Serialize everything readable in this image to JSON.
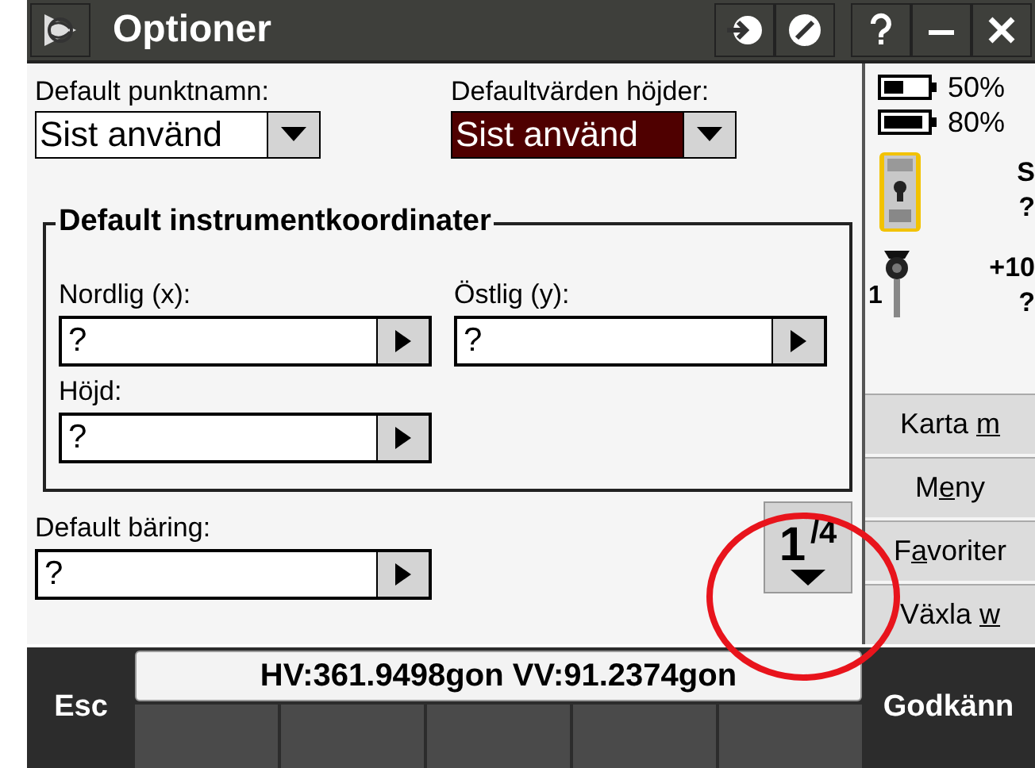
{
  "window": {
    "title": "Optioner"
  },
  "top_fields": [
    {
      "label": "Default punktnamn:",
      "value": "Sist använd",
      "selected": false
    },
    {
      "label": "Defaultvärden höjder:",
      "value": "Sist använd",
      "selected": true
    }
  ],
  "group": {
    "title": "Default instrumentkoordinater",
    "fields": [
      {
        "label": "Nordlig (x):",
        "value": "?"
      },
      {
        "label": "Östlig (y):",
        "value": "?"
      },
      {
        "label": "Höjd:",
        "value": "?"
      }
    ]
  },
  "bearing": {
    "label": "Default bäring:",
    "value": "?"
  },
  "page_button": "1$^{/4}$",
  "status": {
    "batteries": [
      "50%",
      "80%"
    ],
    "instrument": [
      "S",
      "?"
    ],
    "target": {
      "number": "1",
      "offset": "+10",
      "value": "?"
    }
  },
  "softkeys": [
    {
      "pre": "Karta ",
      "key": "m"
    },
    {
      "pre": "M",
      "key": "e",
      "post": "ny"
    },
    {
      "pre": "F",
      "key": "a",
      "post": "voriter"
    },
    {
      "pre": "Växla ",
      "key": "w"
    }
  ],
  "bottom": {
    "left": "Esc",
    "readout": "HV:361.9498gon  VV:91.2374gon",
    "right": "Godkänn"
  }
}
